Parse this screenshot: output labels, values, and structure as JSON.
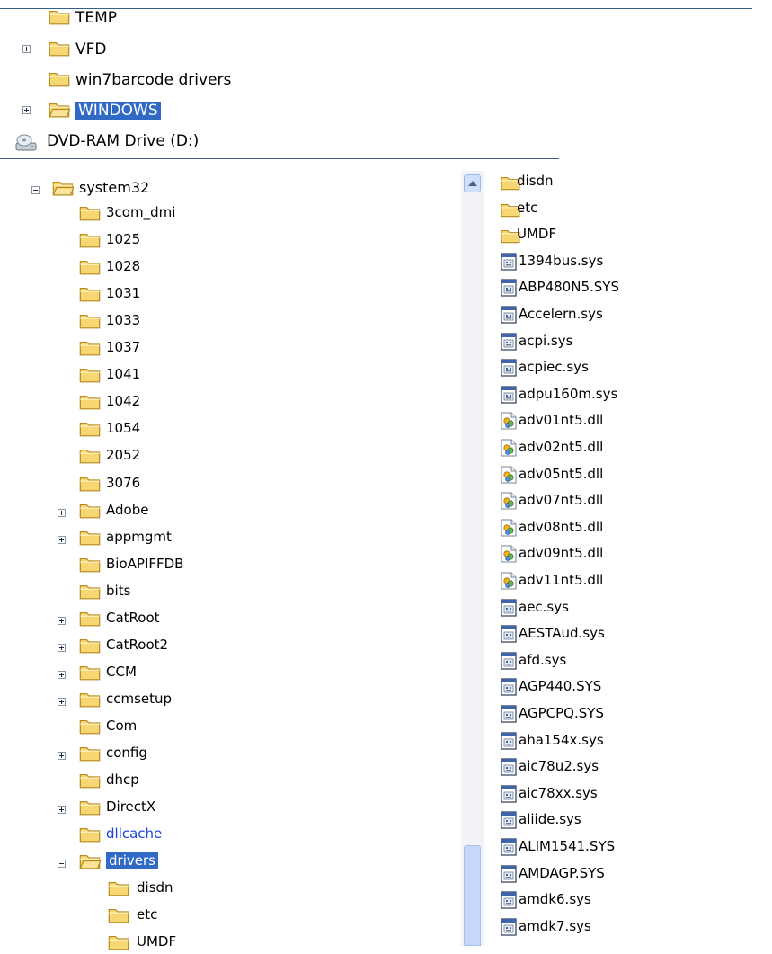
{
  "top_tree": {
    "items": [
      {
        "label": "TEMP",
        "expander": "none",
        "selected": false
      },
      {
        "label": "VFD",
        "expander": "plus",
        "selected": false
      },
      {
        "label": "win7barcode drivers",
        "expander": "none",
        "selected": false
      },
      {
        "label": "WINDOWS",
        "expander": "plus",
        "selected": true
      }
    ],
    "drive": {
      "label": "DVD-RAM Drive (D:)",
      "icon": "dvd-drive-icon"
    }
  },
  "left_tree": {
    "root": {
      "label": "system32",
      "expander": "minus"
    },
    "items": [
      {
        "label": "3com_dmi",
        "expander": "none"
      },
      {
        "label": "1025",
        "expander": "none"
      },
      {
        "label": "1028",
        "expander": "none"
      },
      {
        "label": "1031",
        "expander": "none"
      },
      {
        "label": "1033",
        "expander": "none"
      },
      {
        "label": "1037",
        "expander": "none"
      },
      {
        "label": "1041",
        "expander": "none"
      },
      {
        "label": "1042",
        "expander": "none"
      },
      {
        "label": "1054",
        "expander": "none"
      },
      {
        "label": "2052",
        "expander": "none"
      },
      {
        "label": "3076",
        "expander": "none"
      },
      {
        "label": "Adobe",
        "expander": "plus"
      },
      {
        "label": "appmgmt",
        "expander": "plus"
      },
      {
        "label": "BioAPIFFDB",
        "expander": "none"
      },
      {
        "label": "bits",
        "expander": "none"
      },
      {
        "label": "CatRoot",
        "expander": "plus"
      },
      {
        "label": "CatRoot2",
        "expander": "plus"
      },
      {
        "label": "CCM",
        "expander": "plus"
      },
      {
        "label": "ccmsetup",
        "expander": "plus"
      },
      {
        "label": "Com",
        "expander": "none"
      },
      {
        "label": "config",
        "expander": "plus"
      },
      {
        "label": "dhcp",
        "expander": "none"
      },
      {
        "label": "DirectX",
        "expander": "plus"
      },
      {
        "label": "dllcache",
        "expander": "none",
        "style": "link"
      },
      {
        "label": "drivers",
        "expander": "minus",
        "style": "selected"
      }
    ],
    "children": [
      {
        "label": "disdn"
      },
      {
        "label": "etc"
      },
      {
        "label": "UMDF"
      }
    ]
  },
  "file_list": {
    "items": [
      {
        "label": "disdn",
        "type": "folder"
      },
      {
        "label": "etc",
        "type": "folder"
      },
      {
        "label": "UMDF",
        "type": "folder"
      },
      {
        "label": "1394bus.sys",
        "type": "sys"
      },
      {
        "label": "ABP480N5.SYS",
        "type": "sys"
      },
      {
        "label": "Accelern.sys",
        "type": "sys"
      },
      {
        "label": "acpi.sys",
        "type": "sys"
      },
      {
        "label": "acpiec.sys",
        "type": "sys"
      },
      {
        "label": "adpu160m.sys",
        "type": "sys"
      },
      {
        "label": "adv01nt5.dll",
        "type": "dll"
      },
      {
        "label": "adv02nt5.dll",
        "type": "dll"
      },
      {
        "label": "adv05nt5.dll",
        "type": "dll"
      },
      {
        "label": "adv07nt5.dll",
        "type": "dll"
      },
      {
        "label": "adv08nt5.dll",
        "type": "dll"
      },
      {
        "label": "adv09nt5.dll",
        "type": "dll"
      },
      {
        "label": "adv11nt5.dll",
        "type": "dll"
      },
      {
        "label": "aec.sys",
        "type": "sys"
      },
      {
        "label": "AESTAud.sys",
        "type": "sys"
      },
      {
        "label": "afd.sys",
        "type": "sys"
      },
      {
        "label": "AGP440.SYS",
        "type": "sys"
      },
      {
        "label": "AGPCPQ.SYS",
        "type": "sys"
      },
      {
        "label": "aha154x.sys",
        "type": "sys"
      },
      {
        "label": "aic78u2.sys",
        "type": "sys"
      },
      {
        "label": "aic78xx.sys",
        "type": "sys"
      },
      {
        "label": "aliide.sys",
        "type": "sys"
      },
      {
        "label": "ALIM1541.SYS",
        "type": "sys"
      },
      {
        "label": "AMDAGP.SYS",
        "type": "sys"
      },
      {
        "label": "amdk6.sys",
        "type": "sys"
      },
      {
        "label": "amdk7.sys",
        "type": "sys"
      }
    ]
  },
  "colors": {
    "selection": "#316ac5",
    "link": "#1a44d8",
    "folder_fill": "#f7d774",
    "folder_stroke": "#b58a1d"
  }
}
